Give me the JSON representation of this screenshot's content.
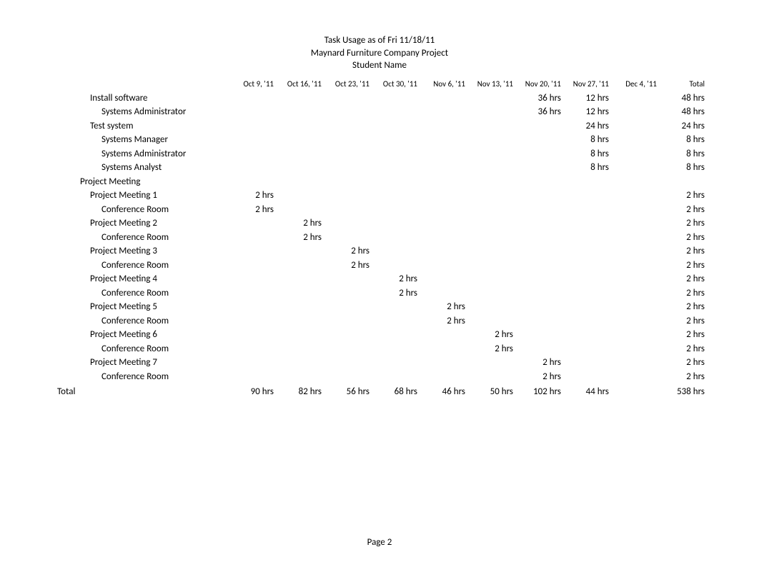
{
  "header": {
    "line1": "Task Usage as of Fri 11/18/11",
    "line2": "Maynard Furniture Company Project",
    "line3": "Student Name"
  },
  "columns": [
    "Oct 9, '11",
    "Oct 16, '11",
    "Oct 23, '11",
    "Oct 30, '11",
    "Nov 6, '11",
    "Nov 13, '11",
    "Nov 20, '11",
    "Nov 27, '11",
    "Dec 4, '11",
    "Total"
  ],
  "rows": [
    {
      "name": "Install software",
      "indent": 2,
      "vals": [
        "",
        "",
        "",
        "",
        "",
        "",
        "36 hrs",
        "12 hrs",
        "",
        "48 hrs"
      ]
    },
    {
      "name": "Systems Administrator",
      "indent": 3,
      "vals": [
        "",
        "",
        "",
        "",
        "",
        "",
        "36 hrs",
        "12 hrs",
        "",
        "48 hrs"
      ]
    },
    {
      "name": "Test system",
      "indent": 2,
      "vals": [
        "",
        "",
        "",
        "",
        "",
        "",
        "",
        "24 hrs",
        "",
        "24 hrs"
      ]
    },
    {
      "name": "Systems Manager",
      "indent": 3,
      "vals": [
        "",
        "",
        "",
        "",
        "",
        "",
        "",
        "8 hrs",
        "",
        "8 hrs"
      ]
    },
    {
      "name": "Systems Administrator",
      "indent": 3,
      "vals": [
        "",
        "",
        "",
        "",
        "",
        "",
        "",
        "8 hrs",
        "",
        "8 hrs"
      ]
    },
    {
      "name": "Systems Analyst",
      "indent": 3,
      "vals": [
        "",
        "",
        "",
        "",
        "",
        "",
        "",
        "8 hrs",
        "",
        "8 hrs"
      ]
    },
    {
      "name": "Project Meeting",
      "indent": 1,
      "vals": [
        "",
        "",
        "",
        "",
        "",
        "",
        "",
        "",
        "",
        ""
      ]
    },
    {
      "name": "Project Meeting 1",
      "indent": 2,
      "vals": [
        "2 hrs",
        "",
        "",
        "",
        "",
        "",
        "",
        "",
        "",
        "2 hrs"
      ]
    },
    {
      "name": "Conference Room",
      "indent": 3,
      "vals": [
        "2 hrs",
        "",
        "",
        "",
        "",
        "",
        "",
        "",
        "",
        "2 hrs"
      ]
    },
    {
      "name": "Project Meeting 2",
      "indent": 2,
      "vals": [
        "",
        "2 hrs",
        "",
        "",
        "",
        "",
        "",
        "",
        "",
        "2 hrs"
      ]
    },
    {
      "name": "Conference Room",
      "indent": 3,
      "vals": [
        "",
        "2 hrs",
        "",
        "",
        "",
        "",
        "",
        "",
        "",
        "2 hrs"
      ]
    },
    {
      "name": "Project Meeting 3",
      "indent": 2,
      "vals": [
        "",
        "",
        "2 hrs",
        "",
        "",
        "",
        "",
        "",
        "",
        "2 hrs"
      ]
    },
    {
      "name": "Conference Room",
      "indent": 3,
      "vals": [
        "",
        "",
        "2 hrs",
        "",
        "",
        "",
        "",
        "",
        "",
        "2 hrs"
      ]
    },
    {
      "name": "Project Meeting 4",
      "indent": 2,
      "vals": [
        "",
        "",
        "",
        "2 hrs",
        "",
        "",
        "",
        "",
        "",
        "2 hrs"
      ]
    },
    {
      "name": "Conference Room",
      "indent": 3,
      "vals": [
        "",
        "",
        "",
        "2 hrs",
        "",
        "",
        "",
        "",
        "",
        "2 hrs"
      ]
    },
    {
      "name": "Project Meeting 5",
      "indent": 2,
      "vals": [
        "",
        "",
        "",
        "",
        "2 hrs",
        "",
        "",
        "",
        "",
        "2 hrs"
      ]
    },
    {
      "name": "Conference Room",
      "indent": 3,
      "vals": [
        "",
        "",
        "",
        "",
        "2 hrs",
        "",
        "",
        "",
        "",
        "2 hrs"
      ]
    },
    {
      "name": "Project Meeting 6",
      "indent": 2,
      "vals": [
        "",
        "",
        "",
        "",
        "",
        "2 hrs",
        "",
        "",
        "",
        "2 hrs"
      ]
    },
    {
      "name": "Conference Room",
      "indent": 3,
      "vals": [
        "",
        "",
        "",
        "",
        "",
        "2 hrs",
        "",
        "",
        "",
        "2 hrs"
      ]
    },
    {
      "name": "Project Meeting 7",
      "indent": 2,
      "vals": [
        "",
        "",
        "",
        "",
        "",
        "",
        "2 hrs",
        "",
        "",
        "2 hrs"
      ]
    },
    {
      "name": "Conference Room",
      "indent": 3,
      "vals": [
        "",
        "",
        "",
        "",
        "",
        "",
        "2 hrs",
        "",
        "",
        "2 hrs"
      ]
    }
  ],
  "total": {
    "label": "Total",
    "vals": [
      "90 hrs",
      "82 hrs",
      "56 hrs",
      "68 hrs",
      "46 hrs",
      "50 hrs",
      "102 hrs",
      "44 hrs",
      "",
      "538 hrs"
    ]
  },
  "footer": "Page 2"
}
